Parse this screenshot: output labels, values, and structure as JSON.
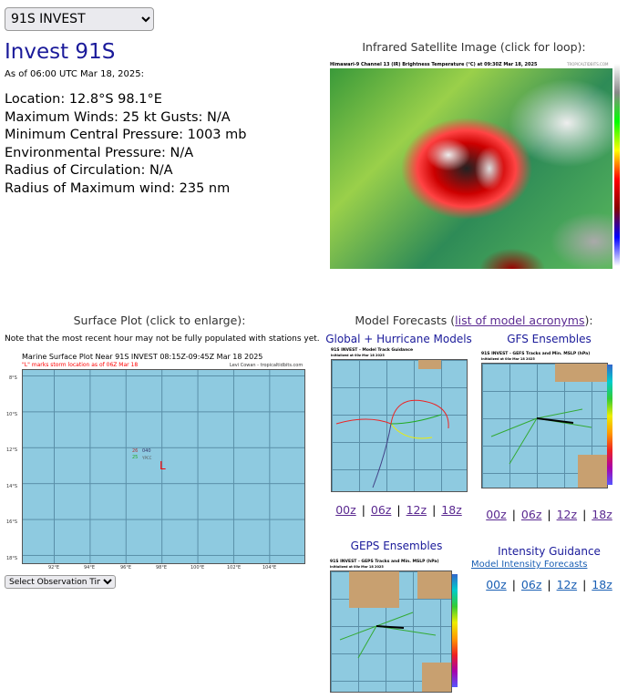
{
  "storm_select": {
    "value": "91S INVEST"
  },
  "storm": {
    "title": "Invest 91S",
    "as_of": "As of 06:00 UTC Mar 18, 2025:",
    "stats": [
      "Location: 12.8°S 98.1°E",
      "Maximum Winds: 25 kt  Gusts: N/A",
      "Minimum Central Pressure: 1003 mb",
      "Environmental Pressure: N/A",
      "Radius of Circulation: N/A",
      "Radius of Maximum wind: 235 nm"
    ]
  },
  "satellite": {
    "heading": "Infrared Satellite Image (click for loop):",
    "caption": "Himawari-9 Channel 13 (IR) Brightness Temperature (°C) at 09:30Z Mar 18, 2025",
    "credit": "TROPICALTIDBITS.COM"
  },
  "surface": {
    "heading": "Surface Plot (click to enlarge):",
    "note": "Note that the most recent hour may not be fully populated with stations yet.",
    "caption": "Marine Surface Plot Near 91S INVEST 08:15Z-09:45Z Mar 18 2025",
    "subcaption": "\"L\" marks storm location as of 06Z Mar 18",
    "credit": "Levi Cowan - tropicaltidbits.com",
    "lat_ticks": [
      "8°S",
      "10°S",
      "12°S",
      "14°S",
      "16°S",
      "18°S"
    ],
    "lon_ticks": [
      "92°E",
      "94°E",
      "96°E",
      "98°E",
      "100°E",
      "102°E",
      "104°E"
    ],
    "station": {
      "temp": "26",
      "pressure": "040",
      "dew": "25",
      "id": "YPCC"
    },
    "storm_marker": "L",
    "select_label": "Select Observation Time..."
  },
  "models": {
    "heading_pre": "Model Forecasts (",
    "heading_link": "list of model acronyms",
    "heading_post": "):",
    "global": {
      "title": "Global + Hurricane Models",
      "caption": "91S INVEST - Model Track Guidance",
      "init": "Initialized at 00z Mar 18 2025"
    },
    "gfs": {
      "title": "GFS Ensembles",
      "caption": "91S INVEST - GEFS Tracks and Min. MSLP (hPa)",
      "init": "Initialized at 00z Mar 18 2025"
    },
    "geps": {
      "title": "GEPS Ensembles",
      "caption": "91S INVEST - GEPS Tracks and Min. MSLP (hPa)",
      "init": "Initialized at 00z Mar 18 2025"
    },
    "intensity": {
      "title": "Intensity Guidance",
      "link": "Model Intensity Forecasts"
    },
    "runs": [
      "00z",
      "06z",
      "12z",
      "18z"
    ],
    "separator": "|"
  }
}
